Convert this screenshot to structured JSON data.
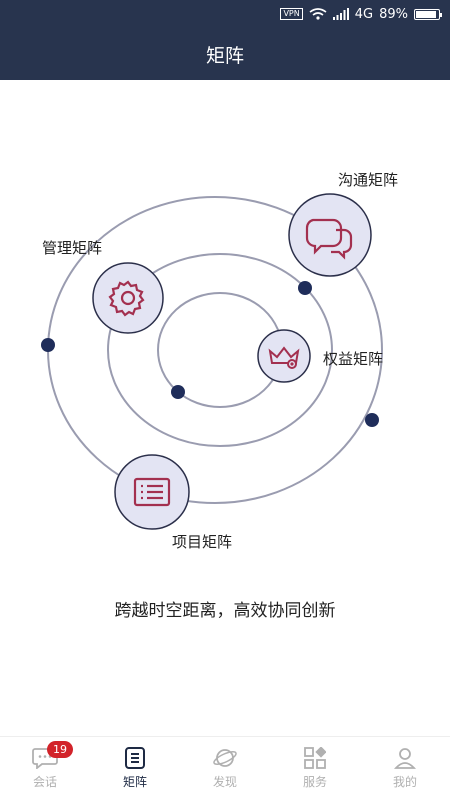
{
  "status_bar": {
    "vpn": "VPN",
    "network": "4G",
    "battery": "89%",
    "battery_level": 0.89
  },
  "header": {
    "title": "矩阵"
  },
  "matrix": {
    "nodes": {
      "communication": {
        "label": "沟通矩阵",
        "icon": "chat-bubbles-icon"
      },
      "management": {
        "label": "管理矩阵",
        "icon": "gear-icon"
      },
      "rights": {
        "label": "权益矩阵",
        "icon": "crown-icon"
      },
      "project": {
        "label": "项目矩阵",
        "icon": "list-icon"
      }
    },
    "colors": {
      "ring": "#9a9cb0",
      "dot": "#1f2d5a",
      "node_fill": "#e3e4f3",
      "node_stroke": "#2b2f4a",
      "icon": "#a3304f"
    }
  },
  "slogan": "跨越时空距离，高效协同创新",
  "tabs": [
    {
      "label": "会话",
      "icon": "chat-icon",
      "badge": "19"
    },
    {
      "label": "矩阵",
      "icon": "matrix-icon",
      "active": true
    },
    {
      "label": "发现",
      "icon": "planet-icon"
    },
    {
      "label": "服务",
      "icon": "grid-icon"
    },
    {
      "label": "我的",
      "icon": "user-icon"
    }
  ],
  "theme": {
    "header_bg": "#28344e",
    "active_tab": "#1e2a44",
    "inactive_tab": "#b0b0b0",
    "badge": "#d2232a"
  }
}
